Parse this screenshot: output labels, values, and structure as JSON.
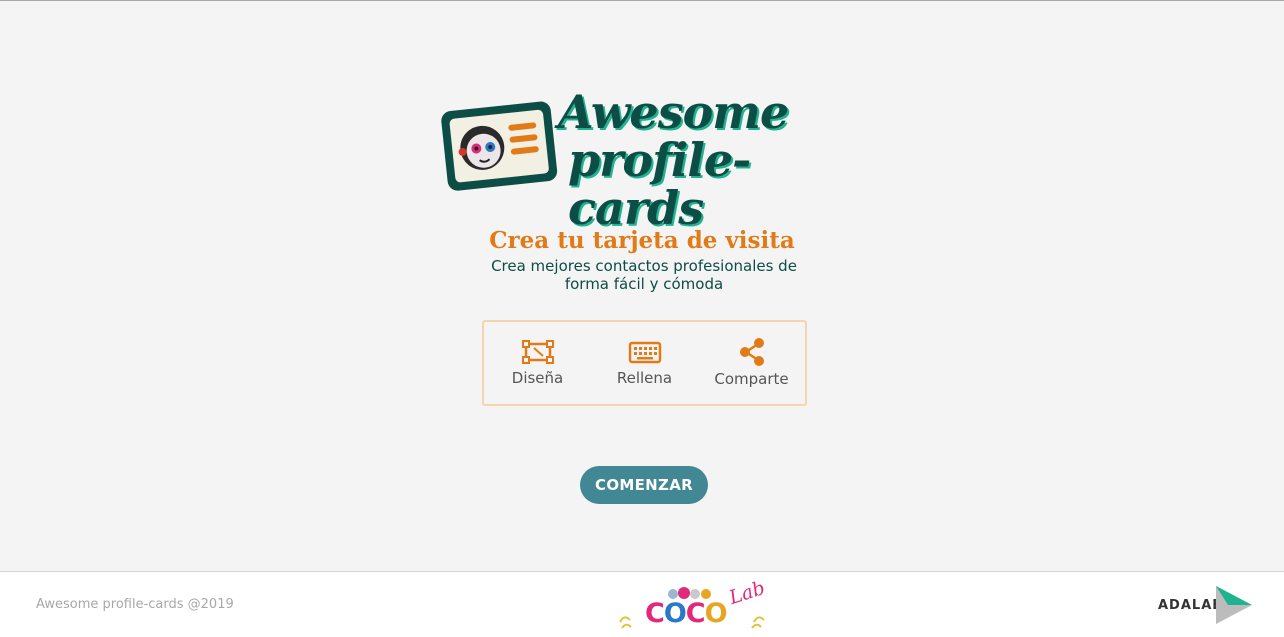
{
  "brand": {
    "logo_line1": "Awesome",
    "logo_line2": "profile-cards"
  },
  "hero": {
    "title": "Crea tu tarjeta de visita",
    "subtitle": "Crea mejores contactos profesionales de forma fácil y cómoda"
  },
  "steps": [
    {
      "label": "Diseña",
      "icon": "design-frame-icon"
    },
    {
      "label": "Rellena",
      "icon": "keyboard-icon"
    },
    {
      "label": "Comparte",
      "icon": "share-icon"
    }
  ],
  "cta": {
    "label": "COMENZAR"
  },
  "footer": {
    "copyright": "Awesome profile-cards @2019",
    "team_logo": {
      "main": [
        "C",
        "O",
        "C",
        "O"
      ],
      "script": "Lab"
    },
    "sponsor_logo": "ADALAB"
  },
  "colors": {
    "accent_orange": "#e17b17",
    "brand_green": "#0c4d45",
    "button_teal": "#428794"
  }
}
